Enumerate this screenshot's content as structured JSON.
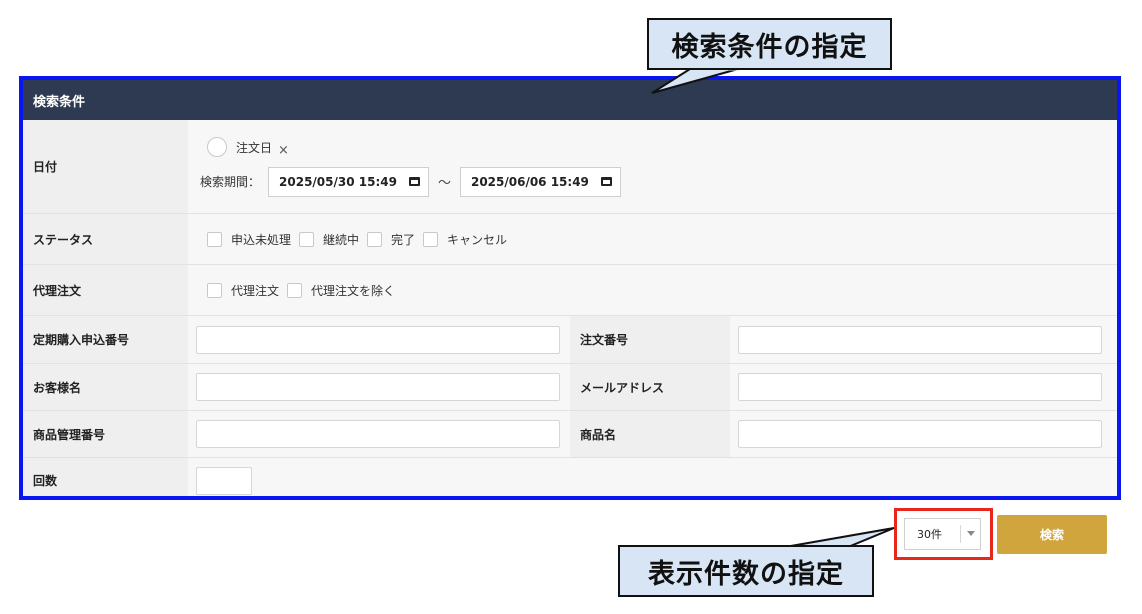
{
  "callouts": {
    "search_conditions": "検索条件の指定",
    "display_count": "表示件数の指定"
  },
  "panel": {
    "header": "検索条件",
    "date": {
      "label": "日付",
      "radio_label": "注文日",
      "clear_icon": "×",
      "period_label": "検索期間：",
      "start": "2025/05/30 15:49",
      "tilde": "〜",
      "end": "2025/06/06 15:49"
    },
    "status": {
      "label": "ステータス",
      "options": [
        "申込未処理",
        "継続中",
        "完了",
        "キャンセル"
      ]
    },
    "proxy": {
      "label": "代理注文",
      "options": [
        "代理注文",
        "代理注文を除く"
      ]
    },
    "fields": {
      "subscription_no": "定期購入申込番号",
      "order_no": "注文番号",
      "customer_name": "お客様名",
      "email": "メールアドレス",
      "product_code": "商品管理番号",
      "product_name": "商品名",
      "count": "回数"
    }
  },
  "footer": {
    "per_page": "30件",
    "search_button": "検索"
  },
  "colors": {
    "header_bg": "#2d3a52",
    "panel_border": "#0a16f0",
    "highlight_border": "#e8261d",
    "search_button": "#d1a53d",
    "callout_bg": "#d7e5f5"
  }
}
